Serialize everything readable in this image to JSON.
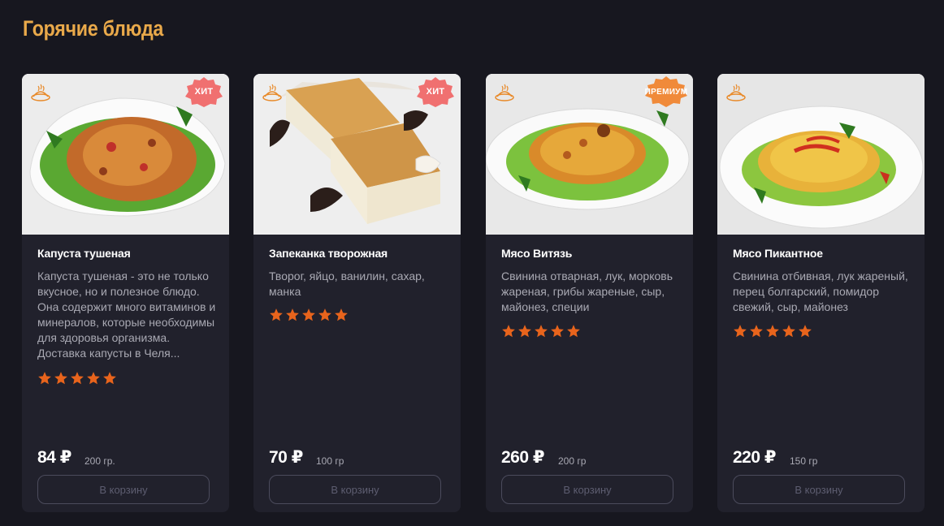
{
  "section": {
    "title": "Горячие блюда"
  },
  "colors": {
    "accent": "#e9a94a",
    "star": "#e8641c",
    "badge_hit": "#f07070",
    "badge_premium": "#f08a3a"
  },
  "cards": [
    {
      "name": "Капуста тушеная",
      "description": "Капуста тушеная - это не только вкусное, но и полезное блюдо. Она содержит много витаминов и минералов, которые необходимы для здоровья организма. Доставка капусты в Челя...",
      "badge": "ХИТ",
      "rating": 5,
      "price": "84 ₽",
      "weight": "200 гр.",
      "button": "В корзину"
    },
    {
      "name": "Запеканка творожная",
      "description": "Творог, яйцо, ванилин, сахар, манка",
      "badge": "ХИТ",
      "rating": 5,
      "price": "70 ₽",
      "weight": "100 гр",
      "button": "В корзину"
    },
    {
      "name": "Мясо Витязь",
      "description": "Свинина отварная, лук, морковь жареная, грибы жареные, сыр, майонез, специи",
      "badge": "ПРЕМИУМ",
      "rating": 5,
      "price": "260 ₽",
      "weight": "200 гр",
      "button": "В корзину"
    },
    {
      "name": "Мясо Пикантное",
      "description": "Свинина отбивная, лук жареный, перец болгарский, помидор свежий, сыр, майонез",
      "badge": "",
      "rating": 5,
      "price": "220 ₽",
      "weight": "150 гр",
      "button": "В корзину"
    }
  ]
}
